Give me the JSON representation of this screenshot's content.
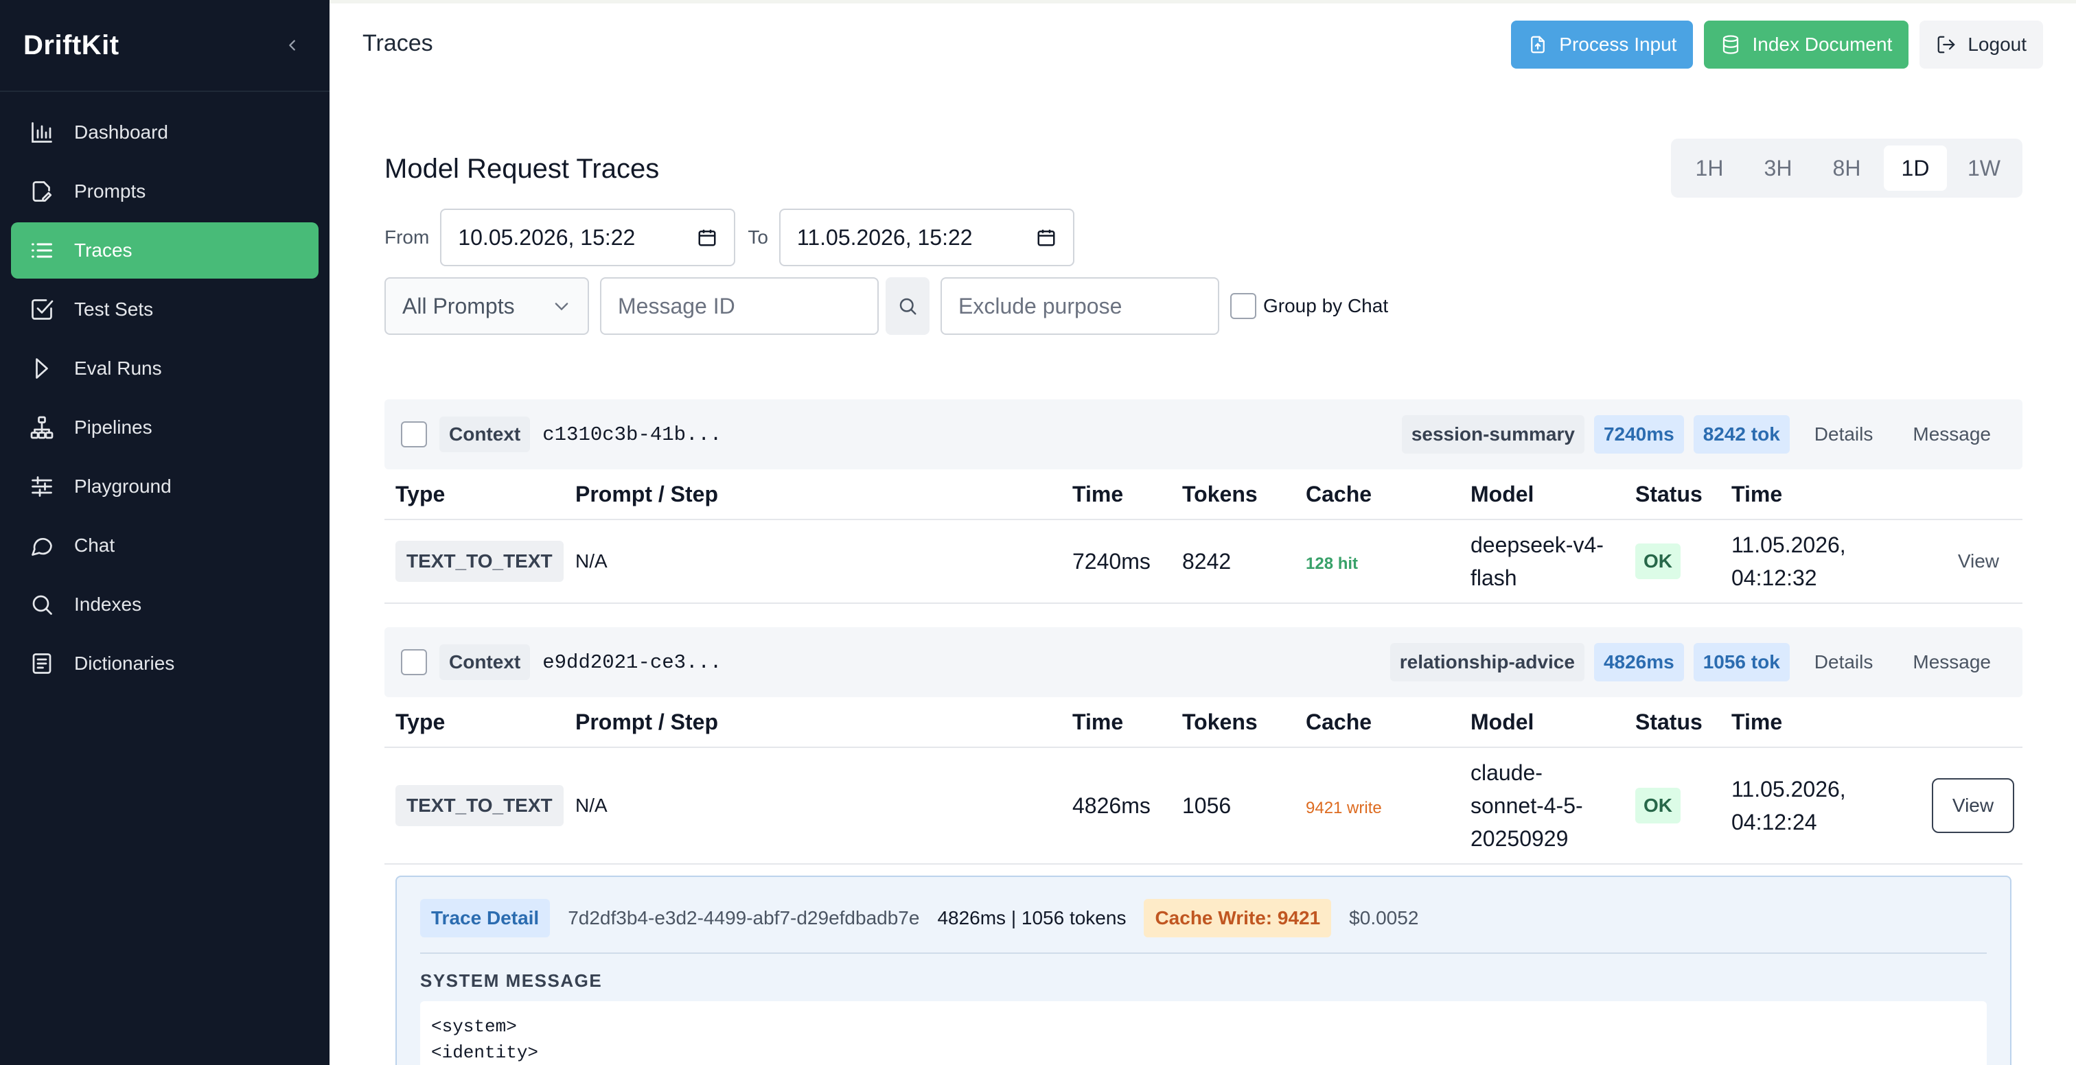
{
  "app": {
    "brand": "DriftKit"
  },
  "sidebar": {
    "items": [
      {
        "label": "Dashboard",
        "icon": "bar-chart-icon",
        "active": false
      },
      {
        "label": "Prompts",
        "icon": "file-edit-icon",
        "active": false
      },
      {
        "label": "Traces",
        "icon": "list-icon",
        "active": true
      },
      {
        "label": "Test Sets",
        "icon": "checkbox-icon",
        "active": false
      },
      {
        "label": "Eval Runs",
        "icon": "play-icon",
        "active": false
      },
      {
        "label": "Pipelines",
        "icon": "network-icon",
        "active": false
      },
      {
        "label": "Playground",
        "icon": "sliders-icon",
        "active": false
      },
      {
        "label": "Chat",
        "icon": "chat-icon",
        "active": false
      },
      {
        "label": "Indexes",
        "icon": "search-icon",
        "active": false
      },
      {
        "label": "Dictionaries",
        "icon": "book-icon",
        "active": false
      }
    ]
  },
  "topbar": {
    "title": "Traces",
    "process_input": "Process Input",
    "index_document": "Index Document",
    "logout": "Logout"
  },
  "main": {
    "section_title": "Model Request Traces",
    "ranges": [
      "1H",
      "3H",
      "8H",
      "1D",
      "1W"
    ],
    "active_range": "1D",
    "from_label": "From",
    "from_value": "10.05.2026, 15:22",
    "to_label": "To",
    "to_value": "11.05.2026, 15:22",
    "prompt_select": "All Prompts",
    "message_id_placeholder": "Message ID",
    "exclude_placeholder": "Exclude purpose",
    "group_by_chat": "Group by Chat"
  },
  "columns": [
    "Type",
    "Prompt / Step",
    "Time",
    "Tokens",
    "Cache",
    "Model",
    "Status",
    "Time"
  ],
  "groups": [
    {
      "context_label": "Context",
      "context_id": "c1310c3b-41b...",
      "purpose": "session-summary",
      "duration": "7240ms",
      "tokens_tag": "8242 tok",
      "details": "Details",
      "message": "Message",
      "row": {
        "type": "TEXT_TO_TEXT",
        "prompt": "N/A",
        "time": "7240ms",
        "tokens": "8242",
        "cache": "128 hit",
        "model_line1": "deepseek-v4-",
        "model_line2": "flash",
        "model_line3": "",
        "status": "OK",
        "date_line1": "11.05.2026,",
        "date_line2": "04:12:32",
        "view": "View"
      }
    },
    {
      "context_label": "Context",
      "context_id": "e9dd2021-ce3...",
      "purpose": "relationship-advice",
      "duration": "4826ms",
      "tokens_tag": "1056 tok",
      "details": "Details",
      "message": "Message",
      "row": {
        "type": "TEXT_TO_TEXT",
        "prompt": "N/A",
        "time": "4826ms",
        "tokens": "1056",
        "cache": "9421 write",
        "model_line1": "claude-",
        "model_line2": "sonnet-4-5-",
        "model_line3": "20250929",
        "status": "OK",
        "date_line1": "11.05.2026,",
        "date_line2": "04:12:24",
        "view": "View"
      }
    }
  ],
  "detail": {
    "tag": "Trace Detail",
    "trace_id": "7d2df3b4-e3d2-4499-abf7-d29efdbadb7e",
    "metrics": "4826ms | 1056 tokens",
    "cache_write": "Cache Write: 9421",
    "cost": "$0.0052",
    "system_title": "SYSTEM MESSAGE",
    "code_line1": "<system>",
    "code_line2": "<identity>"
  },
  "colors": {
    "sidebar_bg": "#111827",
    "accent_green": "#48bb78",
    "accent_blue": "#4ba3e3",
    "cache_hit": "#38a169",
    "cache_write": "#dd6b20"
  }
}
